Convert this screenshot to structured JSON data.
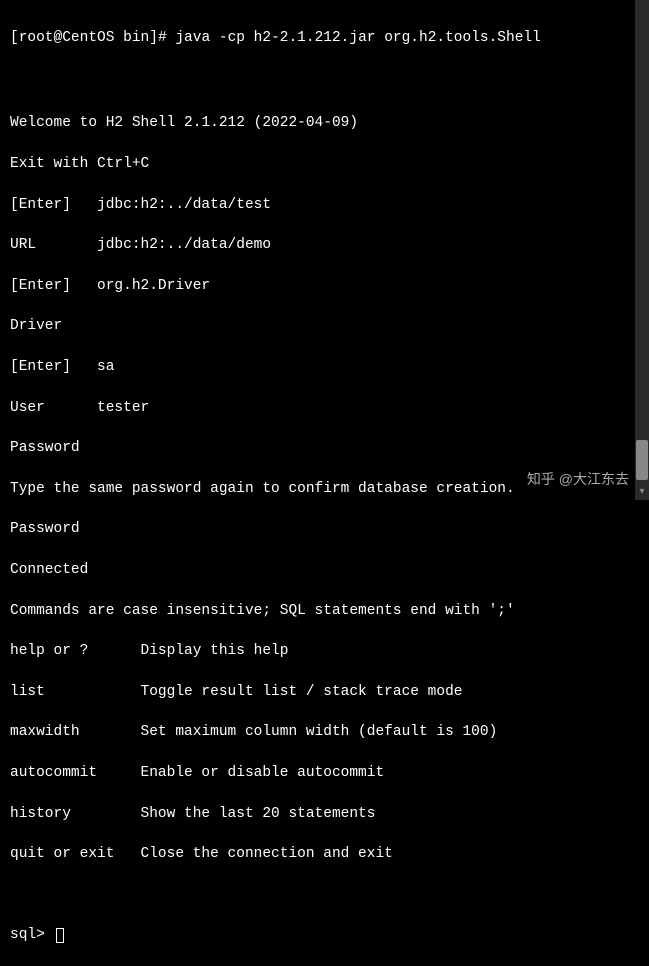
{
  "prompt": {
    "user": "root",
    "host": "CentOS",
    "cwd": "bin",
    "symbol": "#",
    "command": "java -cp h2-2.1.212.jar org.h2.tools.Shell"
  },
  "output": {
    "welcome": "Welcome to H2 Shell 2.1.212 (2022-04-09)",
    "exit_hint": "Exit with Ctrl+C",
    "url_enter": "[Enter]   jdbc:h2:../data/test",
    "url_value": "URL       jdbc:h2:../data/demo",
    "driver_enter": "[Enter]   org.h2.Driver",
    "driver_label": "Driver",
    "user_enter": "[Enter]   sa",
    "user_value": "User      tester",
    "password1": "Password",
    "confirm_msg": "Type the same password again to confirm database creation.",
    "password2": "Password",
    "connected": "Connected",
    "cmd_hint": "Commands are case insensitive; SQL statements end with ';'",
    "help_line": "help or ?      Display this help",
    "list_line": "list           Toggle result list / stack trace mode",
    "maxwidth_line": "maxwidth       Set maximum column width (default is 100)",
    "autocommit_line": "autocommit     Enable or disable autocommit",
    "history_line": "history        Show the last 20 statements",
    "quit_line": "quit or exit   Close the connection and exit"
  },
  "sql_prompt": "sql>",
  "watermark": "知乎 @大江东去"
}
